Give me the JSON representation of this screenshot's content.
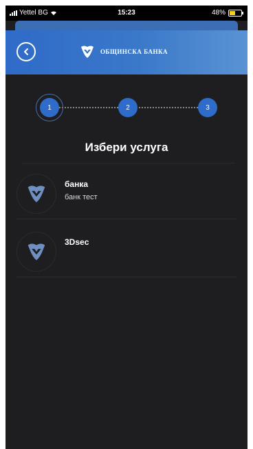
{
  "status_bar": {
    "carrier": "Yettel BG",
    "time": "15:23",
    "battery": "48%",
    "battery_level": 0.48
  },
  "header": {
    "bank_name": "ОБЩИНСКА БАНКА"
  },
  "stepper": {
    "steps": [
      "1",
      "2",
      "3"
    ],
    "active_step": 1
  },
  "page": {
    "title": "Избери услуга"
  },
  "services": [
    {
      "title": "банка",
      "subtitle": "банк тест"
    },
    {
      "title": "3Dsec",
      "subtitle": ""
    }
  ],
  "colors": {
    "accent": "#2f6bc8",
    "background": "#1e1e20",
    "header_gradient_end": "#5a93d4"
  }
}
